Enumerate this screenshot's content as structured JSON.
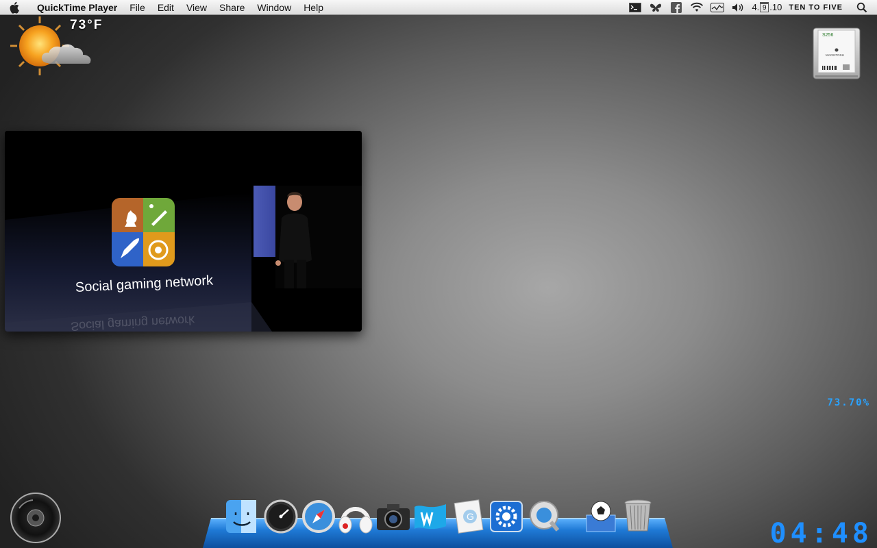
{
  "menubar": {
    "app_name": "QuickTime Player",
    "menus": [
      "File",
      "Edit",
      "View",
      "Share",
      "Window",
      "Help"
    ],
    "status_icons": [
      "terminal-icon",
      "butterfly-icon",
      "facebook-icon",
      "wifi-icon",
      "activity-icon",
      "volume-icon"
    ],
    "clock": {
      "day_prefix": "4.",
      "calendar_day": "9",
      "year_suffix": ".10",
      "words": "TEN TO FIVE"
    },
    "search_icon": "spotlight-search-icon"
  },
  "weather": {
    "temperature": "73°F",
    "icon": "partly-sunny-icon"
  },
  "drive": {
    "label_top": "S256",
    "label_brand": "MACINTOSH",
    "icon": "hard-drive-icon"
  },
  "video": {
    "caption": "Social gaming network",
    "reflection": "Social gaming network",
    "icon": "game-center-icon"
  },
  "battery": {
    "percent_text": "73.70%"
  },
  "digital_clock": {
    "time": "04:48"
  },
  "dock": {
    "items": [
      "finder-icon",
      "dashboard-icon",
      "safari-icon",
      "beats-headphones-icon",
      "camera-icon",
      "word-icon",
      "textedit-icon",
      "system-preferences-icon",
      "quicktime-icon",
      "soccer-downloads-icon",
      "trash-icon"
    ]
  },
  "colors": {
    "accent_blue": "#1f8fff",
    "menubar_bg": "#e6e6e6",
    "dock_blue": "#1f7ad6"
  }
}
